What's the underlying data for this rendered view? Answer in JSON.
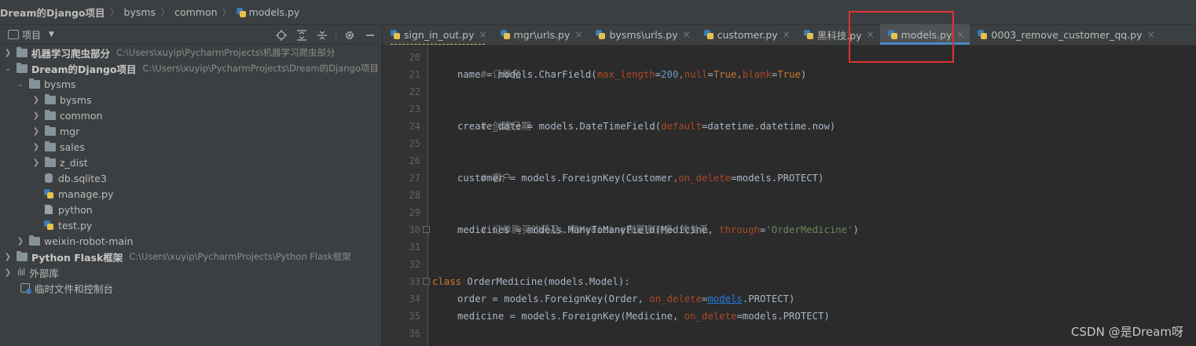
{
  "breadcrumb": [
    "Dream的Django项目",
    "bysms",
    "common",
    "models.py"
  ],
  "project_panel": {
    "title": "项目"
  },
  "tree": [
    {
      "label": "机器学习爬虫部分",
      "path": "C:\\Users\\xuyip\\PycharmProjects\\机器学习爬虫部分"
    },
    {
      "label": "Dream的Django项目",
      "path": "C:\\Users\\xuyip\\PycharmProjects\\Dream的Django项目"
    },
    {
      "label": "bysms"
    },
    {
      "label": "bysms"
    },
    {
      "label": "common"
    },
    {
      "label": "mgr"
    },
    {
      "label": "sales"
    },
    {
      "label": "z_dist"
    },
    {
      "label": "db.sqlite3"
    },
    {
      "label": "manage.py"
    },
    {
      "label": "python"
    },
    {
      "label": "test.py"
    },
    {
      "label": "weixin-robot-main"
    },
    {
      "label": "Python Flask框架",
      "path": "C:\\Users\\xuyip\\PycharmProjects\\Python Flask框架"
    },
    {
      "label": "外部库"
    },
    {
      "label": "临时文件和控制台"
    }
  ],
  "tabs": [
    {
      "label": "sign_in_out.py"
    },
    {
      "label": "mgr\\urls.py"
    },
    {
      "label": "bysms\\urls.py"
    },
    {
      "label": "customer.py"
    },
    {
      "label": "黑科技.py"
    },
    {
      "label": "models.py"
    },
    {
      "label": "0003_remove_customer_qq.py"
    }
  ],
  "code": {
    "line_numbers": [
      "20",
      "21",
      "22",
      "23",
      "24",
      "25",
      "26",
      "27",
      "28",
      "29",
      "30",
      "31",
      "32",
      "33",
      "34",
      "35",
      "36"
    ],
    "comment_order_name": "# 订单名",
    "comment_create_date": "# 创建日期",
    "comment_customer": "# 客户",
    "comment_medicines": "# 订单购买的药品，和Medicine表是多对多 的关系",
    "l21": {
      "a": "name = models.",
      "fn": "CharField",
      "b": "(",
      "p1": "max_length",
      "eq1": "=",
      "n1": "200",
      "c1": ",",
      "p2": "null",
      "eq2": "=",
      "k2": "True",
      "c2": ",",
      "p3": "blank",
      "eq3": "=",
      "k3": "True",
      "end": ")"
    },
    "l24": {
      "a": "create_date = models.",
      "fn": "DateTimeField",
      "b": "(",
      "p1": "default",
      "rest": "=datetime.datetime.now)"
    },
    "l27": {
      "a": "customer = models.",
      "fn": "ForeignKey",
      "b": "(Customer",
      "c": ",",
      "p1": "on_delete",
      "rest": "=models.PROTECT)"
    },
    "l30": {
      "a": "medicines = models.",
      "fn": "ManyToManyField",
      "b": "(Medicine, ",
      "p1": "through",
      "eq": "=",
      "s": "'OrderMedicine'",
      "end": ")"
    },
    "l33": {
      "kw": "class",
      "rest": " OrderMedicine(models.Model):"
    },
    "l34": {
      "a": "order = models.",
      "fn": "ForeignKey",
      "b": "(Order, ",
      "p1": "on_delete",
      "eq": "=",
      "u": "models",
      "rest": ".PROTECT)"
    },
    "l35": {
      "a": "medicine = models.",
      "fn": "ForeignKey",
      "b": "(Medicine, ",
      "p1": "on_delete",
      "rest": "=models.PROTECT)"
    }
  },
  "watermark": "CSDN @是Dream呀",
  "colors": {
    "accent": "#4a88c7",
    "highlight_box": "#e03131"
  }
}
